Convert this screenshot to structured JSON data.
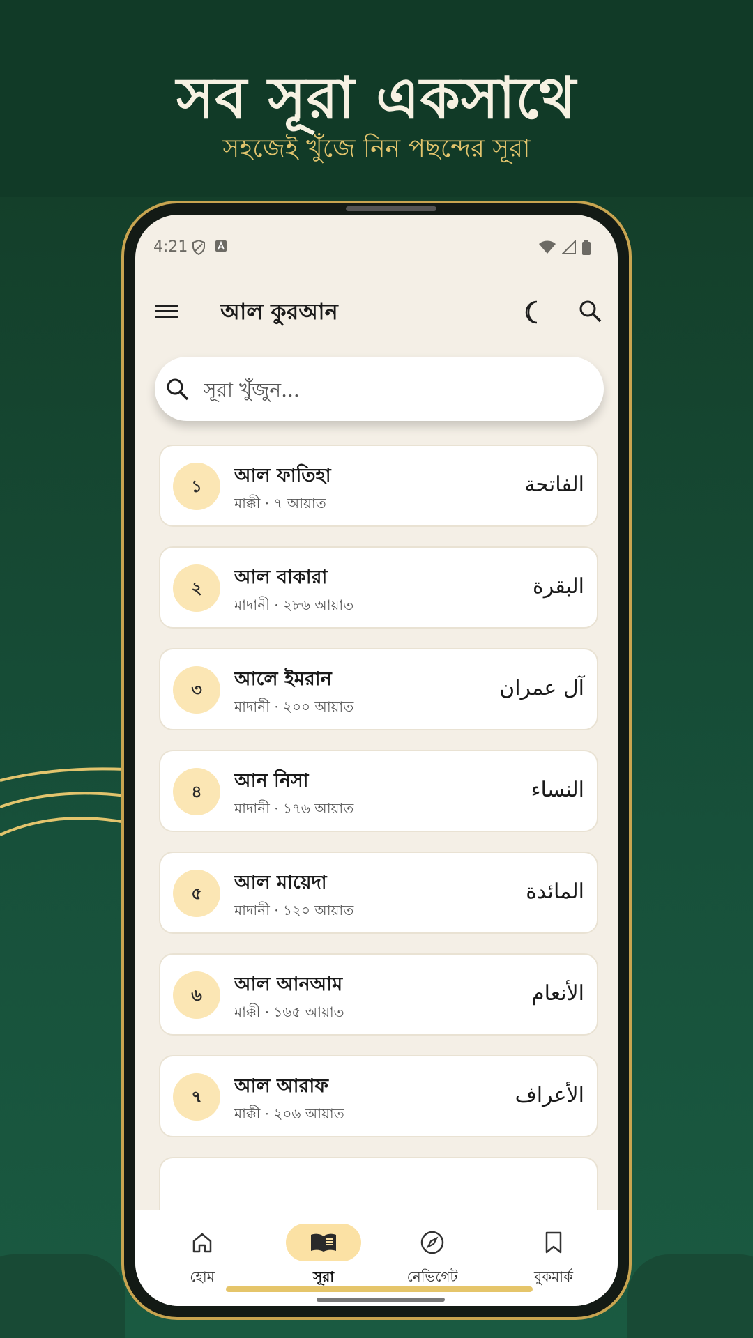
{
  "promo": {
    "headline": "সব সূরা একসাথে",
    "subline": "সহজেই খুঁজে নিন পছন্দের সূরা"
  },
  "status_bar": {
    "time": "4:21"
  },
  "app_bar": {
    "title": "আল কুরআন"
  },
  "search": {
    "placeholder": "সূরা খুঁজুন..."
  },
  "surahs": [
    {
      "number": "১",
      "name": "আল ফাতিহা",
      "meta": "মাক্কী · ৭ আয়াত",
      "arabic": "الفاتحة"
    },
    {
      "number": "২",
      "name": "আল বাকারা",
      "meta": "মাদানী · ২৮৬ আয়াত",
      "arabic": "البقرة"
    },
    {
      "number": "৩",
      "name": "আলে ইমরান",
      "meta": "মাদানী · ২০০ আয়াত",
      "arabic": "آل عمران"
    },
    {
      "number": "৪",
      "name": "আন নিসা",
      "meta": "মাদানী · ১৭৬ আয়াত",
      "arabic": "النساء"
    },
    {
      "number": "৫",
      "name": "আল মায়েদা",
      "meta": "মাদানী · ১২০ আয়াত",
      "arabic": "المائدة"
    },
    {
      "number": "৬",
      "name": "আল আনআম",
      "meta": "মাক্কী · ১৬৫ আয়াত",
      "arabic": "الأنعام"
    },
    {
      "number": "৭",
      "name": "আল আরাফ",
      "meta": "মাক্কী · ২০৬ আয়াত",
      "arabic": "الأعراف"
    }
  ],
  "bottom_nav": {
    "home": "হোম",
    "surah": "সূরা",
    "navigate": "নেভিগেট",
    "bookmark": "বুকমার্ক"
  },
  "colors": {
    "background_green": "#113b27",
    "gold_accent": "#c8a450",
    "number_circle": "#fbe6b4",
    "screen_bg": "#f4efe6"
  }
}
